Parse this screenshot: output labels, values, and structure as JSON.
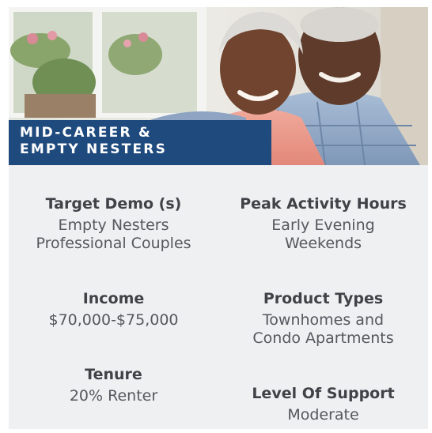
{
  "banner": {
    "line1": "MID-CAREER &",
    "line2": "EMPTY NESTERS"
  },
  "left": [
    {
      "label": "Target Demo (s)",
      "values": [
        "Empty Nesters",
        "Professional Couples"
      ]
    },
    {
      "label": "Income",
      "values": [
        "$70,000-$75,000"
      ]
    },
    {
      "label": "Tenure",
      "values": [
        "20% Renter"
      ]
    }
  ],
  "right": [
    {
      "label": "Peak Activity Hours",
      "values": [
        "Early Evening",
        "Weekends"
      ]
    },
    {
      "label": "Product Types",
      "values": [
        "Townhomes and",
        "Condo Apartments"
      ]
    },
    {
      "label": "Level Of Support",
      "values": [
        "Moderate"
      ]
    }
  ],
  "colors": {
    "banner": "#1f4a7d",
    "panel": "#eef0f2",
    "label_text": "#3f4246",
    "value_text": "#55585c"
  }
}
